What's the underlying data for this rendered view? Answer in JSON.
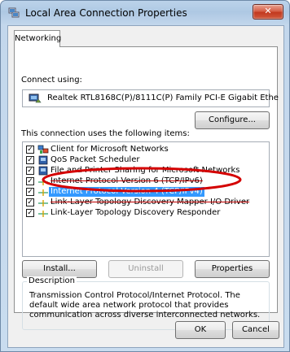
{
  "window": {
    "title": "Local Area Connection Properties",
    "close_label": "✕"
  },
  "tabs": [
    {
      "label": "Networking"
    }
  ],
  "connect_using": {
    "label": "Connect using:",
    "adapter": "Realtek RTL8168C(P)/8111C(P) Family PCI-E Gigabit Ethe",
    "configure_button": "Configure..."
  },
  "items_section": {
    "label": "This connection uses the following items:",
    "items": [
      {
        "label": "Client for Microsoft Networks",
        "checked": true,
        "icon": "network-client-icon"
      },
      {
        "label": "QoS Packet Scheduler",
        "checked": true,
        "icon": "service-icon"
      },
      {
        "label": "File and Printer Sharing for Microsoft Networks",
        "checked": true,
        "icon": "service-icon"
      },
      {
        "label": "Internet Protocol Version 6 (TCP/IPv6)",
        "checked": true,
        "icon": "protocol-icon"
      },
      {
        "label": "Internet Protocol Version 4 (TCP/IPv4)",
        "checked": true,
        "icon": "protocol-icon",
        "selected": true
      },
      {
        "label": "Link-Layer Topology Discovery Mapper I/O Driver",
        "checked": true,
        "icon": "protocol-icon"
      },
      {
        "label": "Link-Layer Topology Discovery Responder",
        "checked": true,
        "icon": "protocol-icon"
      }
    ]
  },
  "buttons": {
    "install": "Install...",
    "uninstall": "Uninstall",
    "properties": "Properties",
    "ok": "OK",
    "cancel": "Cancel"
  },
  "description": {
    "legend": "Description",
    "text": "Transmission Control Protocol/Internet Protocol. The default wide area network protocol that provides communication across diverse interconnected networks."
  },
  "colors": {
    "selection": "#3399ff",
    "annotation": "#d40000"
  }
}
